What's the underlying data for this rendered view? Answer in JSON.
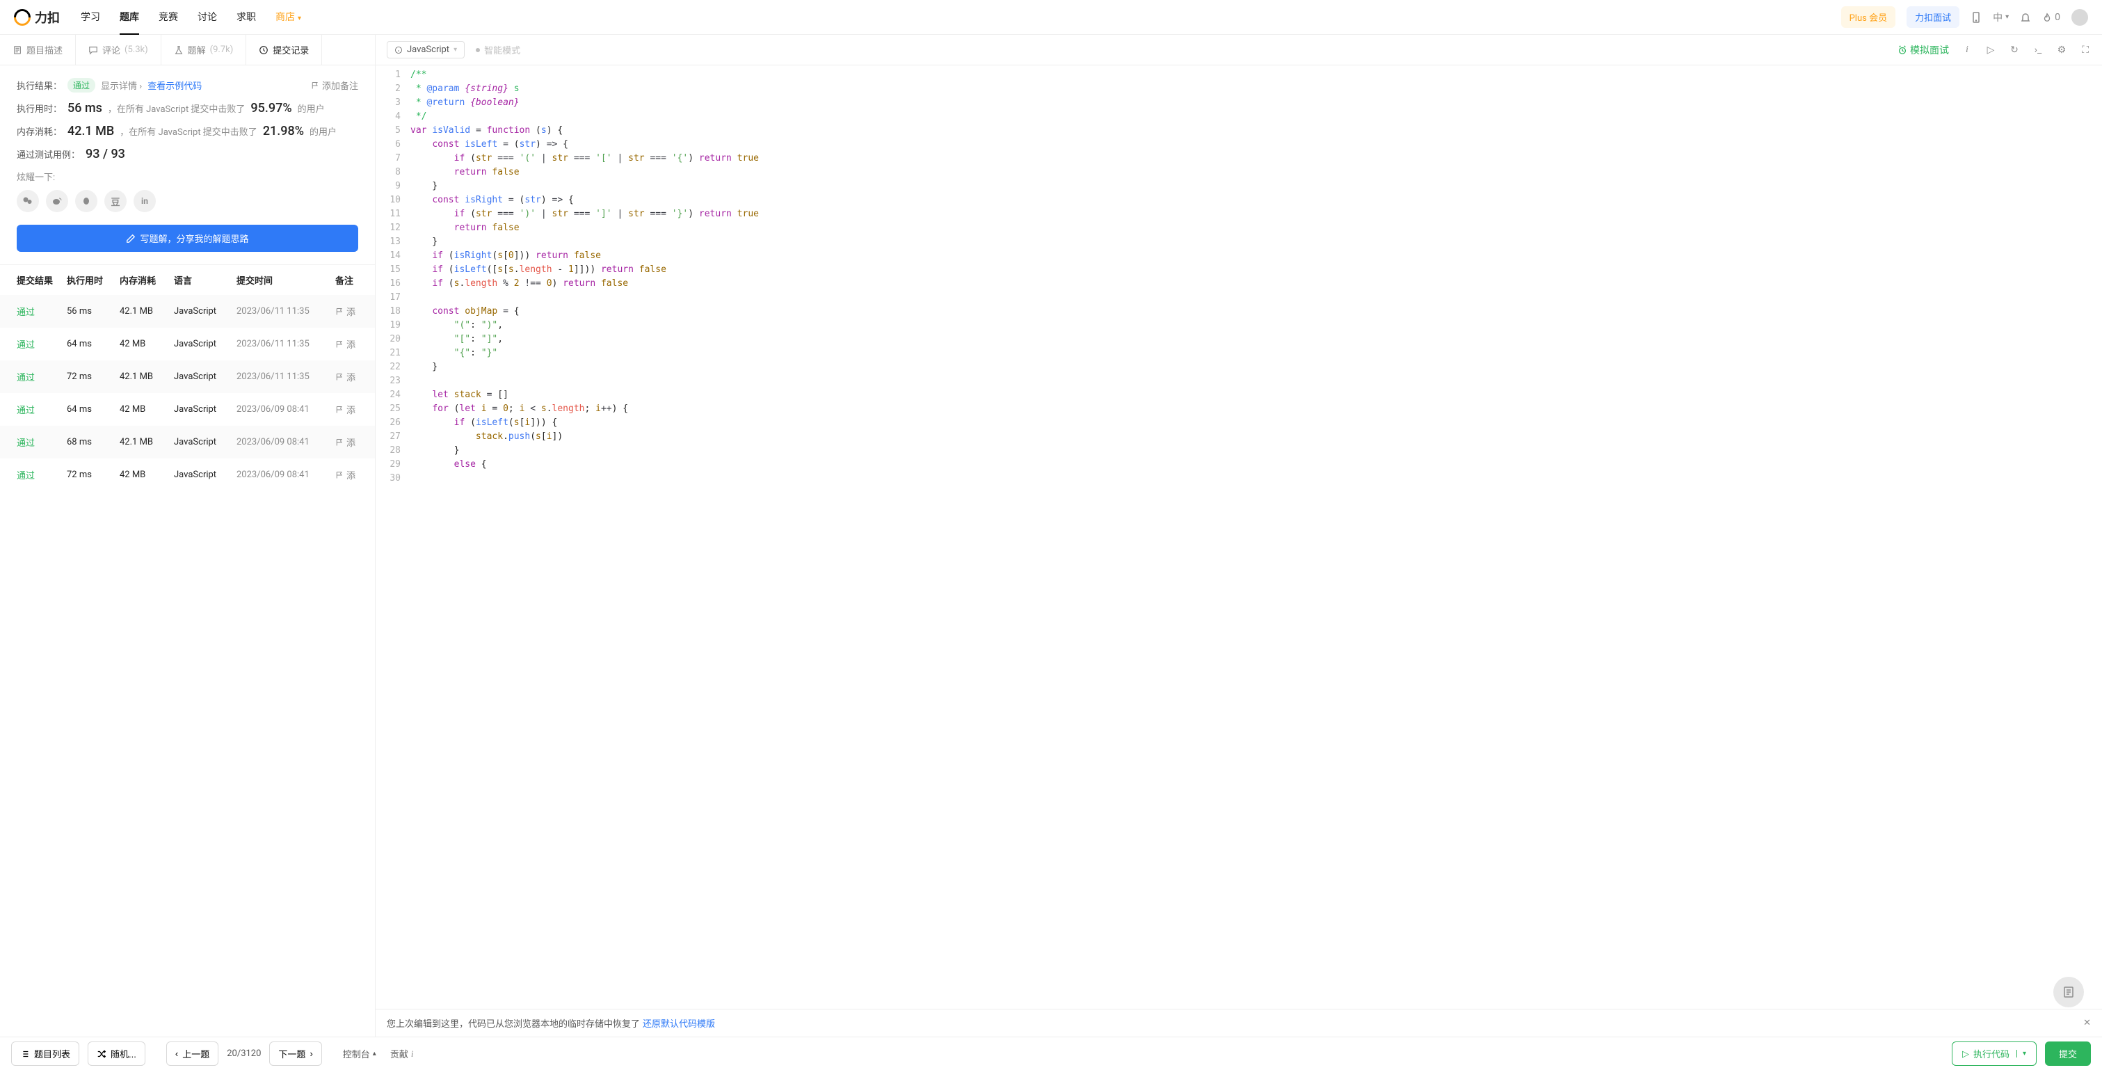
{
  "brand": "力扣",
  "nav": {
    "study": "学习",
    "problems": "题库",
    "contest": "竞赛",
    "discuss": "讨论",
    "jobs": "求职",
    "store": "商店"
  },
  "header": {
    "plus": "Plus 会员",
    "interview": "力扣面试",
    "lang_short": "中",
    "fire_count": "0"
  },
  "tabs": {
    "description": "题目描述",
    "comments": "评论",
    "comments_count": "(5.3k)",
    "solutions": "题解",
    "solutions_count": "(9.7k)",
    "submissions": "提交记录"
  },
  "result": {
    "exec_label": "执行结果：",
    "status": "通过",
    "show_detail": "显示详情",
    "view_sample": "查看示例代码",
    "add_note": "添加备注",
    "runtime_label": "执行用时：",
    "runtime": "56 ms",
    "runtime_desc_a": "，在所有 JavaScript 提交中击败了",
    "runtime_pct": "95.97%",
    "runtime_desc_b": "的用户",
    "memory_label": "内存消耗：",
    "memory": "42.1 MB",
    "memory_desc_a": "，在所有 JavaScript 提交中击败了",
    "memory_pct": "21.98%",
    "memory_desc_b": "的用户",
    "tests_label": "通过测试用例：",
    "tests": "93 / 93",
    "share_label": "炫耀一下:",
    "write_solution": "写题解，分享我的解题思路"
  },
  "table": {
    "h_result": "提交结果",
    "h_runtime": "执行用时",
    "h_memory": "内存消耗",
    "h_lang": "语言",
    "h_time": "提交时间",
    "h_note": "备注",
    "note_prefix": "添",
    "rows": [
      {
        "result": "通过",
        "runtime": "56 ms",
        "memory": "42.1 MB",
        "lang": "JavaScript",
        "time": "2023/06/11 11:35"
      },
      {
        "result": "通过",
        "runtime": "64 ms",
        "memory": "42 MB",
        "lang": "JavaScript",
        "time": "2023/06/11 11:35"
      },
      {
        "result": "通过",
        "runtime": "72 ms",
        "memory": "42.1 MB",
        "lang": "JavaScript",
        "time": "2023/06/11 11:35"
      },
      {
        "result": "通过",
        "runtime": "64 ms",
        "memory": "42 MB",
        "lang": "JavaScript",
        "time": "2023/06/09 08:41"
      },
      {
        "result": "通过",
        "runtime": "68 ms",
        "memory": "42.1 MB",
        "lang": "JavaScript",
        "time": "2023/06/09 08:41"
      },
      {
        "result": "通过",
        "runtime": "72 ms",
        "memory": "42 MB",
        "lang": "JavaScript",
        "time": "2023/06/09 08:41"
      }
    ]
  },
  "editor": {
    "language": "JavaScript",
    "smart_mode": "智能模式",
    "mock": "模拟面试",
    "restore_msg": "您上次编辑到这里，代码已从您浏览器本地的临时存储中恢复了",
    "restore_link": "还原默认代码模版"
  },
  "footer": {
    "problem_list": "题目列表",
    "random": "随机...",
    "prev": "上一题",
    "progress": "20/3120",
    "next": "下一题",
    "console": "控制台",
    "contribute": "贡献",
    "run": "执行代码",
    "submit": "提交"
  }
}
